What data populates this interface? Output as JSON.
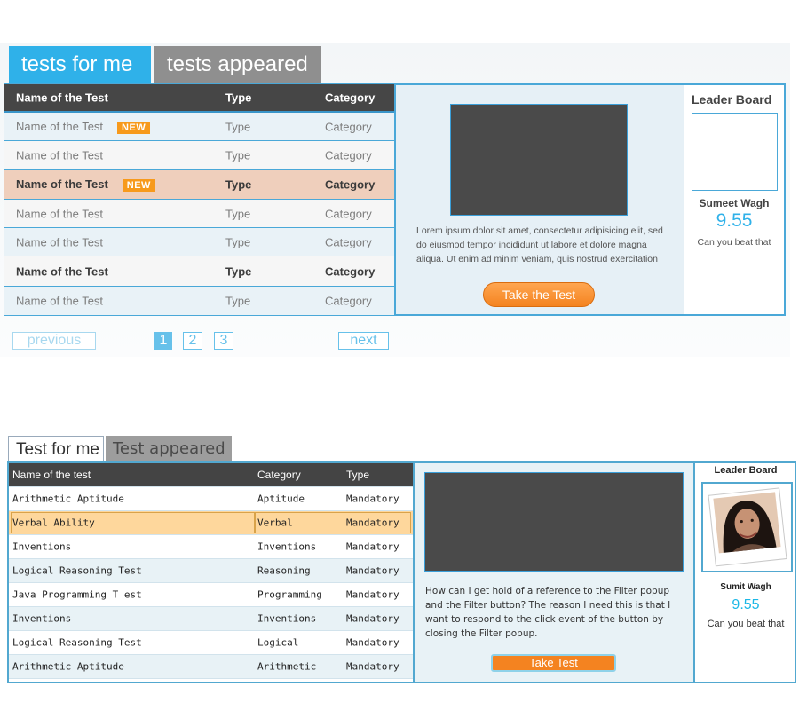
{
  "top": {
    "tabs": [
      {
        "label": "tests for me",
        "active": true
      },
      {
        "label": "tests appeared",
        "active": false
      }
    ],
    "columns": [
      "Name of the Test",
      "Type",
      "Category"
    ],
    "new_badge": "NEW",
    "rows": [
      {
        "name": "Name of the Test",
        "type": "Type",
        "category": "Category",
        "new": true
      },
      {
        "name": "Name of the Test",
        "type": "Type",
        "category": "Category",
        "new": false
      },
      {
        "name": "Name of the Test",
        "type": "Type",
        "category": "Category",
        "new": true,
        "selected": true
      },
      {
        "name": "Name of the Test",
        "type": "Type",
        "category": "Category",
        "new": false
      },
      {
        "name": "Name of the Test",
        "type": "Type",
        "category": "Category",
        "new": false
      },
      {
        "name": "Name of the Test",
        "type": "Type",
        "category": "Category",
        "new": false,
        "emphasis": true
      },
      {
        "name": "Name of the Test",
        "type": "Type",
        "category": "Category",
        "new": false
      }
    ],
    "description": "Lorem ipsum dolor sit amet, consectetur adipisicing elit, sed do eiusmod tempor incididunt ut labore et dolore magna aliqua. Ut enim ad minim veniam, quis nostrud exercitation",
    "take_button": "Take the Test",
    "leaderboard": {
      "title": "Leader Board",
      "name": "Sumeet Wagh",
      "score": "9.55",
      "cta": "Can you beat that"
    },
    "pagination": {
      "previous": "previous",
      "pages": [
        "1",
        "2",
        "3"
      ],
      "current": "1",
      "next": "next"
    }
  },
  "bottom": {
    "tabs": [
      {
        "label": "Test for me",
        "active": true
      },
      {
        "label": "Test appeared",
        "active": false
      }
    ],
    "columns": [
      "Name of the test",
      "Category",
      "Type"
    ],
    "rows": [
      {
        "name": "Arithmetic Aptitude",
        "category": "Aptitude",
        "type": "Mandatory"
      },
      {
        "name": "Verbal Ability",
        "category": "Verbal",
        "type": "Mandatory",
        "selected": true
      },
      {
        "name": "Inventions",
        "category": "Inventions",
        "type": "Mandatory"
      },
      {
        "name": "Logical Reasoning Test",
        "category": "Reasoning",
        "type": "Mandatory"
      },
      {
        "name": "Java Programming T est",
        "category": "Programming",
        "type": "Mandatory"
      },
      {
        "name": "Inventions",
        "category": "Inventions",
        "type": "Mandatory"
      },
      {
        "name": "Logical Reasoning Test",
        "category": "Logical",
        "type": "Mandatory"
      },
      {
        "name": "Arithmetic Aptitude",
        "category": "Arithmetic",
        "type": "Mandatory"
      }
    ],
    "description": "How can I get hold of a reference to the Filter popup and the Filter button? The reason I need this is that I want to respond to the click event of the button by closing the Filter popup.",
    "take_button": "Take Test",
    "leaderboard": {
      "title": "Leader Board",
      "name": "Sumit Wagh",
      "score": "9.55",
      "cta": "Can you beat that"
    }
  },
  "colors": {
    "accent_blue": "#2fb1e9",
    "orange": "#f48320",
    "highlight_peach": "#efcfbc",
    "highlight_yellow": "#fed79c",
    "dark_header": "#464646"
  }
}
